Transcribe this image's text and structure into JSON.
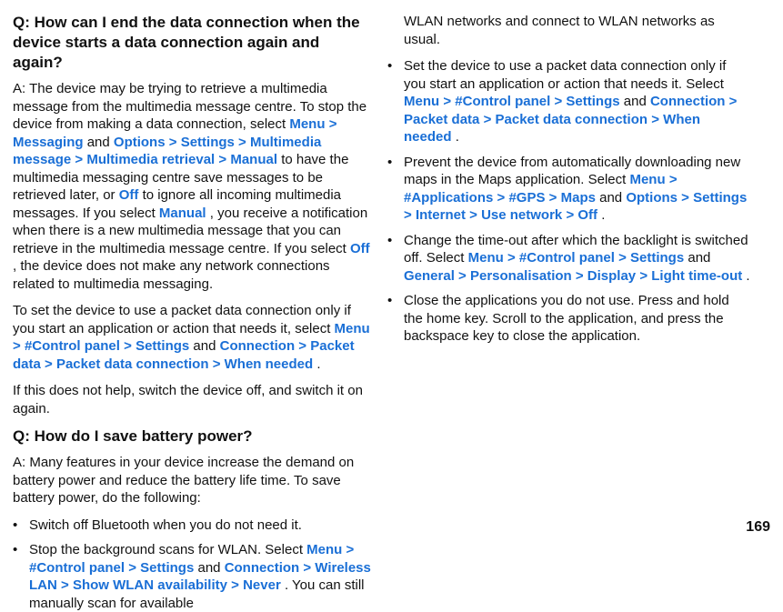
{
  "page_number": "169",
  "link_words": {
    "menu": "Menu",
    "messaging": "Messaging",
    "options": "Options",
    "settings": "Settings",
    "multimedia_message": "Multimedia message",
    "multimedia_retrieval": "Multimedia retrieval",
    "manual": "Manual",
    "off": "Off",
    "control_panel": "#Control panel",
    "connection": "Connection",
    "packet_data": "Packet data",
    "packet_data_connection": "Packet data connection",
    "when_needed": "When needed",
    "wireless_lan": "Wireless LAN",
    "show_wlan": "Show WLAN availability",
    "never": "Never",
    "applications": "#Applications",
    "gps": "#GPS",
    "maps": "Maps",
    "internet": "Internet",
    "use_network": "Use network",
    "general": "General",
    "personalisation": "Personalisation",
    "display": "Display",
    "light_timeout": "Light time-out"
  },
  "left": {
    "q1": "Q: How can I end the data connection when the device starts a data connection again and again?",
    "a1_pre": "A: The device may be trying to retrieve a multimedia message from the multimedia message centre. To stop the device from making a data connection, select ",
    "a1_mid1": " to have the multimedia messaging centre save messages to be retrieved later, or ",
    "a1_mid2": " to ignore all incoming multimedia messages. If you select ",
    "a1_mid3": ", you receive a notification when there is a new multimedia message that you can retrieve in the multimedia message centre. If you select ",
    "a1_post": ", the device does not make any network connections related to multimedia messaging.",
    "a1b_pre": "To set the device to use a packet data connection only if you start an application or action that needs it, select ",
    "a1c": "If this does not help, switch the device off, and switch it on again.",
    "q2": "Q: How do I save battery power?",
    "a2_intro": "A: Many features in your device increase the demand on battery power and reduce the battery life time. To save battery power, do the following:",
    "b1": "Switch off Bluetooth when you do not need it.",
    "b2_pre": "Stop the background scans for WLAN. Select ",
    "b2_post": ". You can still manually scan for available"
  },
  "right": {
    "cont": "WLAN networks and connect to WLAN networks as usual.",
    "b3_pre": "Set the device to use a packet data connection only if you start an application or action that needs it. Select ",
    "b4_pre": "Prevent the device from automatically downloading new maps in the Maps application. Select ",
    "b5_pre": "Change the time-out after which the backlight is switched off. Select ",
    "b6": "Close the applications you do not use. Press and hold the home key. Scroll to the application, and press the backspace key to close the application."
  },
  "and_word": " and ",
  "period": "."
}
